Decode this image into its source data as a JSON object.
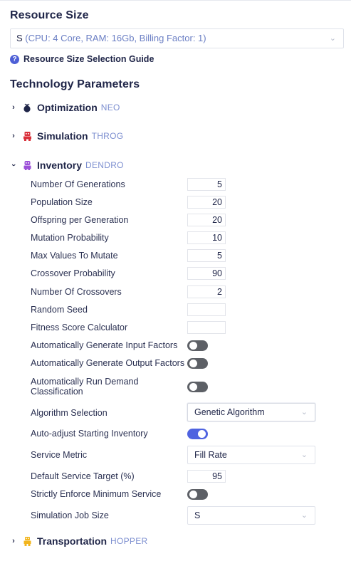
{
  "resource": {
    "title": "Resource Size",
    "select_value": "S",
    "select_suffix": "(CPU: 4 Core, RAM: 16Gb, Billing Factor: 1)",
    "guide_label": "Resource Size Selection Guide"
  },
  "technology": {
    "title": "Technology Parameters",
    "items": [
      {
        "name": "Optimization",
        "code": "NEO",
        "expanded": false,
        "icon": "bomb-icon",
        "color": "#1f2548"
      },
      {
        "name": "Simulation",
        "code": "THROG",
        "expanded": false,
        "icon": "robot-icon",
        "color": "#d9303a"
      },
      {
        "name": "Inventory",
        "code": "DENDRO",
        "expanded": true,
        "icon": "robot-icon",
        "color": "#9b4fd8"
      },
      {
        "name": "Transportation",
        "code": "HOPPER",
        "expanded": false,
        "icon": "robot-icon",
        "color": "#f2b51d"
      }
    ]
  },
  "inventory_params": {
    "number_of_generations": {
      "label": "Number Of Generations",
      "value": "5"
    },
    "population_size": {
      "label": "Population Size",
      "value": "20"
    },
    "offspring_per_generation": {
      "label": "Offspring per Generation",
      "value": "20"
    },
    "mutation_probability": {
      "label": "Mutation Probability",
      "value": "10"
    },
    "max_values_to_mutate": {
      "label": "Max Values To Mutate",
      "value": "5"
    },
    "crossover_probability": {
      "label": "Crossover Probability",
      "value": "90"
    },
    "number_of_crossovers": {
      "label": "Number Of Crossovers",
      "value": "2"
    },
    "random_seed": {
      "label": "Random Seed",
      "value": ""
    },
    "fitness_score_calculator": {
      "label": "Fitness Score Calculator",
      "value": ""
    },
    "auto_generate_input_factors": {
      "label": "Automatically Generate Input Factors",
      "on": false
    },
    "auto_generate_output_factors": {
      "label": "Automatically Generate Output Factors",
      "on": false
    },
    "auto_run_demand_classification": {
      "label_line1": "Automatically Run Demand",
      "label_line2": "Classification",
      "on": false
    },
    "algorithm_selection": {
      "label": "Algorithm Selection",
      "value": "Genetic Algorithm"
    },
    "auto_adjust_starting_inventory": {
      "label": "Auto-adjust Starting Inventory",
      "on": true
    },
    "service_metric": {
      "label": "Service Metric",
      "value": "Fill Rate"
    },
    "default_service_target": {
      "label": "Default Service Target (%)",
      "value": "95"
    },
    "strictly_enforce_minimum_service": {
      "label": "Strictly Enforce Minimum Service",
      "on": false
    },
    "simulation_job_size": {
      "label": "Simulation Job Size",
      "value": "S"
    }
  },
  "colors": {
    "accent": "#4f63e0",
    "toggle_off": "#5d6066",
    "code_text": "#7d8fd0"
  }
}
